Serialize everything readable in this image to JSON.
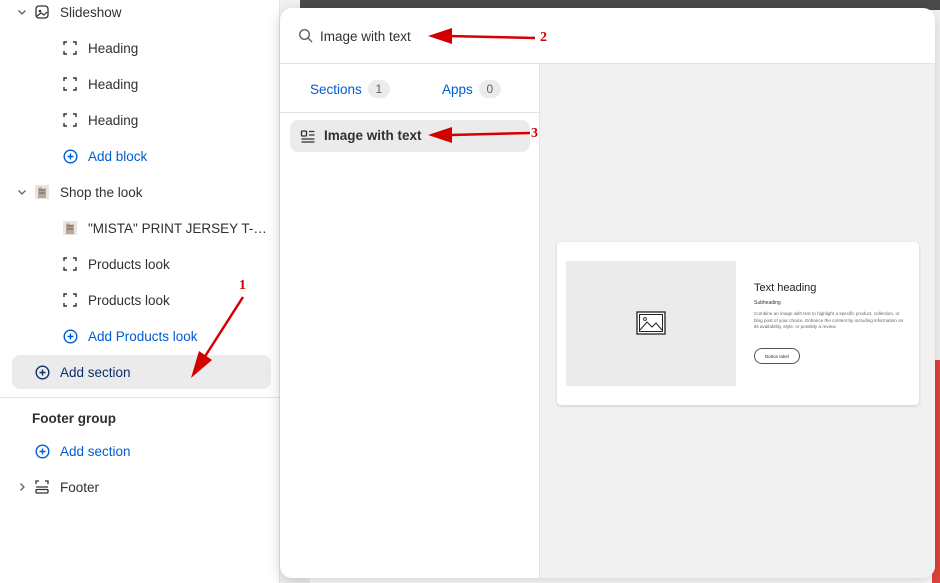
{
  "sidebar": {
    "items": [
      {
        "label": "Slideshow",
        "icon": "slideshow-icon"
      },
      {
        "label": "Heading",
        "icon": "block-icon"
      },
      {
        "label": "Heading",
        "icon": "block-icon"
      },
      {
        "label": "Heading",
        "icon": "block-icon"
      },
      {
        "label": "Add block",
        "icon": "plus-circle-icon"
      },
      {
        "label": "Shop the look",
        "icon": "product-thumbnail-icon"
      },
      {
        "label": "\"MISTA\" PRINT JERSEY T-S...",
        "icon": "product-thumbnail-icon"
      },
      {
        "label": "Products look",
        "icon": "block-icon"
      },
      {
        "label": "Products look",
        "icon": "block-icon"
      },
      {
        "label": "Add Products look",
        "icon": "plus-circle-icon"
      },
      {
        "label": "Add section",
        "icon": "plus-circle-icon"
      }
    ],
    "footer_group": {
      "title": "Footer group",
      "add_section": "Add section",
      "footer": "Footer"
    }
  },
  "popover": {
    "search": {
      "value": "Image with text"
    },
    "tabs": [
      {
        "label": "Sections",
        "count": "1"
      },
      {
        "label": "Apps",
        "count": "0"
      }
    ],
    "result": {
      "label": "Image with text"
    },
    "preview": {
      "heading": "Text heading",
      "subheading": "Subheading",
      "body": "Combine an image with text to highlight a specific product, collection, or blog post of your choice. Enhance the content by including information on its availability, style, or possibly a review.",
      "button": "Button label"
    }
  },
  "annotations": {
    "markers": [
      "1",
      "2",
      "3"
    ],
    "color": "#d40000"
  },
  "colors": {
    "accent": "#005bd3",
    "highlight": "#ebebeb"
  }
}
